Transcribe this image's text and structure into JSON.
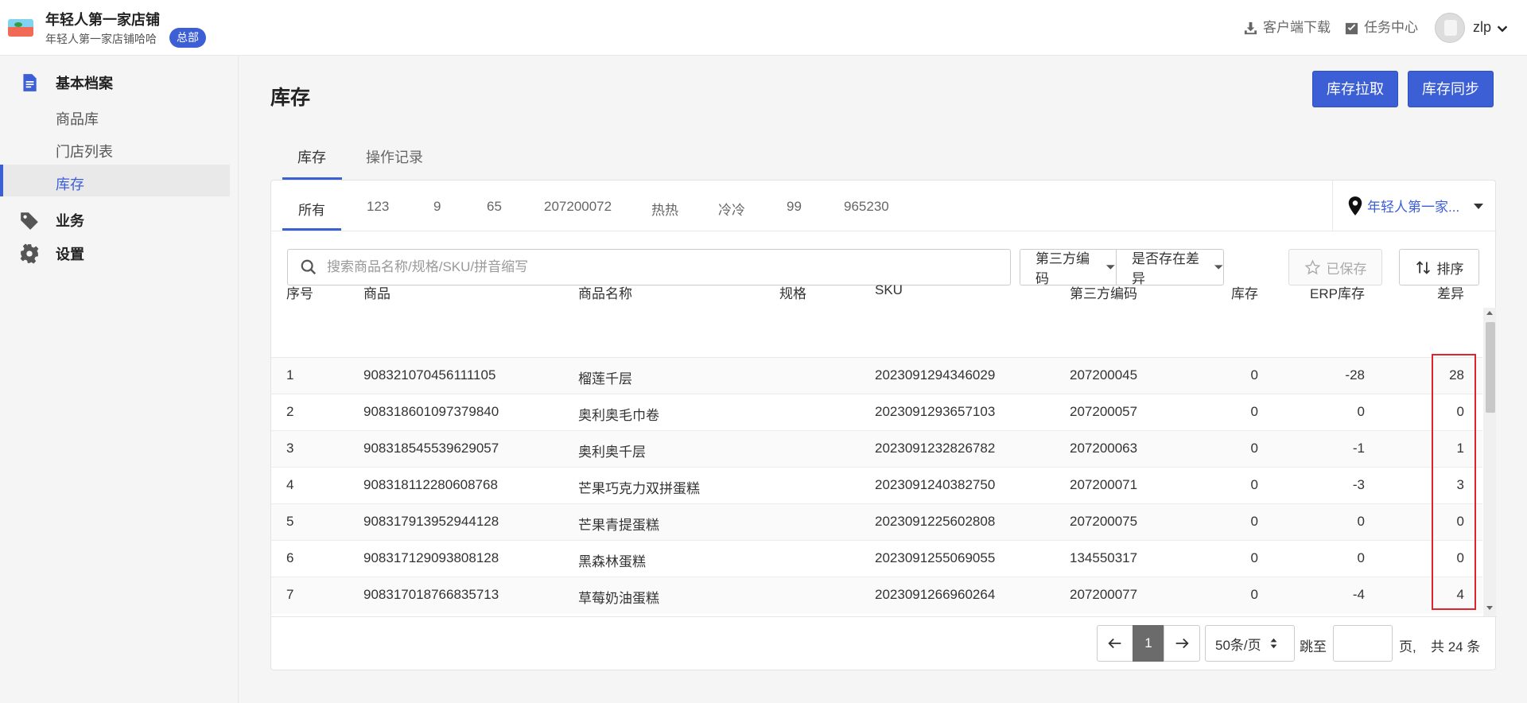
{
  "header": {
    "store_name": "年轻人第一家店铺",
    "store_subtitle": "年轻人第一家店铺哈哈",
    "hq_badge": "总部",
    "download_label": "客户端下载",
    "task_center_label": "任务中心",
    "username": "zlp"
  },
  "sidebar": {
    "group_basic": "基本档案",
    "items": [
      {
        "label": "商品库"
      },
      {
        "label": "门店列表"
      },
      {
        "label": "库存"
      }
    ],
    "group_business": "业务",
    "group_settings": "设置"
  },
  "page": {
    "title": "库存",
    "btn_pull": "库存拉取",
    "btn_sync": "库存同步",
    "tabs": [
      {
        "label": "库存"
      },
      {
        "label": "操作记录"
      }
    ]
  },
  "store_tabs": [
    {
      "label": "所有"
    },
    {
      "label": "123"
    },
    {
      "label": "9"
    },
    {
      "label": "65"
    },
    {
      "label": "207200072"
    },
    {
      "label": "热热"
    },
    {
      "label": "冷冷"
    },
    {
      "label": "99"
    },
    {
      "label": "965230"
    }
  ],
  "store_selector": "年轻人第一家...",
  "filters": {
    "search_placeholder": "搜索商品名称/规格/SKU/拼音缩写",
    "third_party_code": "第三方编码",
    "has_difference": "是否存在差异",
    "saved_label": "已保存",
    "sort_label": "排序"
  },
  "table": {
    "headers": {
      "index": "序号",
      "product": "商品",
      "name": "商品名称",
      "spec": "规格",
      "sku": "SKU",
      "code": "第三方编码",
      "stock": "库存",
      "erp": "ERP库存",
      "diff": "差异"
    },
    "rows": [
      {
        "index": "1",
        "product": "908321070456111105",
        "name": "榴莲千层",
        "spec": "",
        "sku": "2023091294346029",
        "code": "207200045",
        "stock": "0",
        "erp": "-28",
        "diff": "28"
      },
      {
        "index": "2",
        "product": "908318601097379840",
        "name": "奥利奥毛巾卷",
        "spec": "",
        "sku": "2023091293657103",
        "code": "207200057",
        "stock": "0",
        "erp": "0",
        "diff": "0"
      },
      {
        "index": "3",
        "product": "908318545539629057",
        "name": "奥利奥千层",
        "spec": "",
        "sku": "2023091232826782",
        "code": "207200063",
        "stock": "0",
        "erp": "-1",
        "diff": "1"
      },
      {
        "index": "4",
        "product": "908318112280608768",
        "name": "芒果巧克力双拼蛋糕",
        "spec": "",
        "sku": "2023091240382750",
        "code": "207200071",
        "stock": "0",
        "erp": "-3",
        "diff": "3"
      },
      {
        "index": "5",
        "product": "908317913952944128",
        "name": "芒果青提蛋糕",
        "spec": "",
        "sku": "2023091225602808",
        "code": "207200075",
        "stock": "0",
        "erp": "0",
        "diff": "0"
      },
      {
        "index": "6",
        "product": "908317129093808128",
        "name": "黑森林蛋糕",
        "spec": "",
        "sku": "2023091255069055",
        "code": "134550317",
        "stock": "0",
        "erp": "0",
        "diff": "0"
      },
      {
        "index": "7",
        "product": "908317018766835713",
        "name": "草莓奶油蛋糕",
        "spec": "",
        "sku": "2023091266960264",
        "code": "207200077",
        "stock": "0",
        "erp": "-4",
        "diff": "4"
      }
    ]
  },
  "pagination": {
    "current_page": "1",
    "page_size": "50条/页",
    "jump_to": "跳至",
    "page_suffix": "页,",
    "total": "共 24 条"
  },
  "colors": {
    "accent": "#3c5fd6",
    "highlight_border": "#e0242c"
  }
}
